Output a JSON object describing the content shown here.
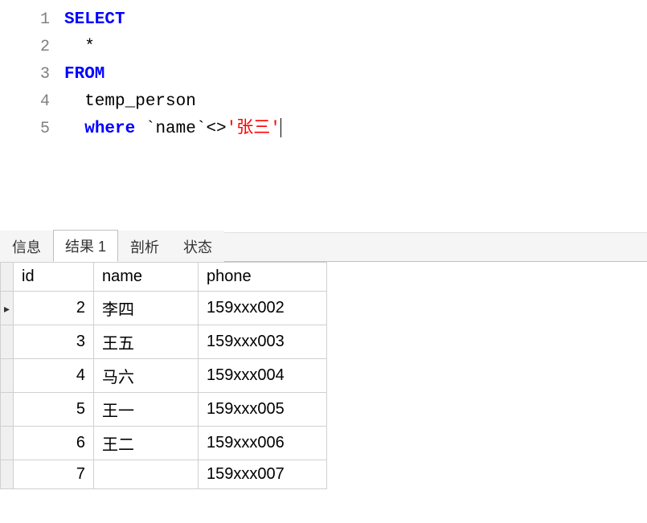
{
  "editor": {
    "lines": [
      {
        "n": 1,
        "tokens": [
          {
            "t": "kw",
            "v": "SELECT"
          }
        ]
      },
      {
        "n": 2,
        "tokens": [
          {
            "t": "ident",
            "v": "  *"
          }
        ]
      },
      {
        "n": 3,
        "tokens": [
          {
            "t": "kw",
            "v": "FROM"
          }
        ]
      },
      {
        "n": 4,
        "tokens": [
          {
            "t": "ident",
            "v": "  temp_person"
          }
        ]
      },
      {
        "n": 5,
        "tokens": [
          {
            "t": "ident",
            "v": "  "
          },
          {
            "t": "kw",
            "v": "where"
          },
          {
            "t": "ident",
            "v": " `name`<>"
          },
          {
            "t": "str",
            "v": "'张三'"
          }
        ],
        "cursor": true
      }
    ]
  },
  "tabs": {
    "items": [
      {
        "label": "信息",
        "active": false
      },
      {
        "label": "结果 1",
        "active": true
      },
      {
        "label": "剖析",
        "active": false
      },
      {
        "label": "状态",
        "active": false
      }
    ]
  },
  "results": {
    "columns": [
      "id",
      "name",
      "phone"
    ],
    "rows": [
      {
        "selected": true,
        "id": "2",
        "name": "李四",
        "phone": "159xxx002"
      },
      {
        "selected": false,
        "id": "3",
        "name": "王五",
        "phone": "159xxx003"
      },
      {
        "selected": false,
        "id": "4",
        "name": "马六",
        "phone": "159xxx004"
      },
      {
        "selected": false,
        "id": "5",
        "name": "王一",
        "phone": "159xxx005"
      },
      {
        "selected": false,
        "id": "6",
        "name": "王二",
        "phone": "159xxx006"
      },
      {
        "selected": false,
        "id": "7",
        "name": "",
        "phone": "159xxx007"
      }
    ]
  }
}
